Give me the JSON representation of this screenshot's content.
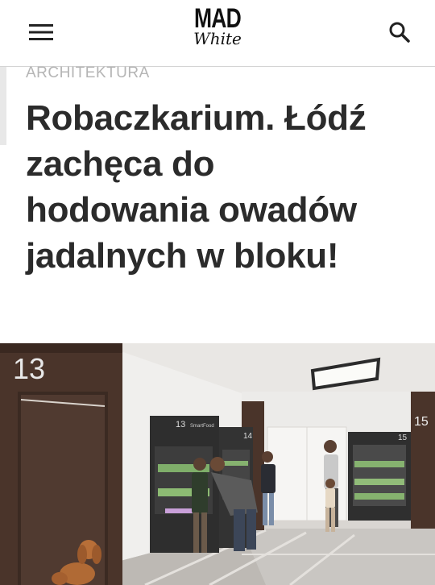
{
  "header": {
    "menu_icon": "hamburger-menu-icon",
    "logo_top": "MAD",
    "logo_bottom": "White",
    "search_icon": "search-icon"
  },
  "article": {
    "category": "ARCHITEKTURA",
    "title": "Robaczkarium. Łódź zachęca do hodowania owadów jadalnych w bloku!"
  },
  "hero": {
    "door_number": "13",
    "cabinet_numbers": [
      "13",
      "14",
      "15"
    ],
    "wall_number": "15",
    "cabinet_label": "SmartFood"
  },
  "colors": {
    "text": "#2b2b2b",
    "category": "#b5b5b5",
    "wood": "#4a342a",
    "cabinet": "#2e2e2e"
  }
}
